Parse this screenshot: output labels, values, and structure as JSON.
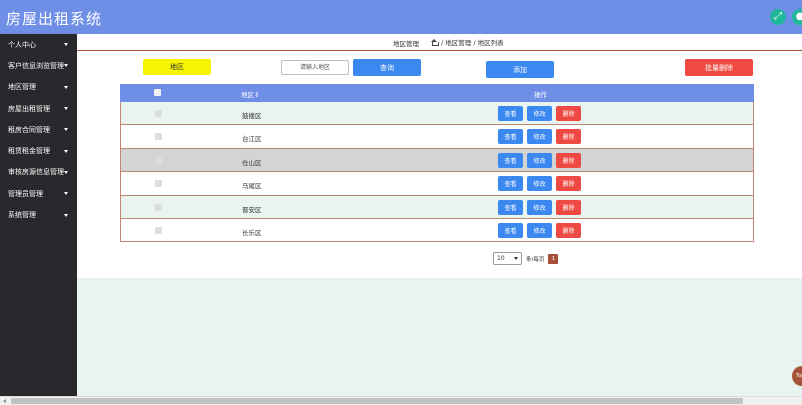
{
  "app": {
    "title": "房屋出租系统"
  },
  "header": {
    "icons": [
      "expand-icon",
      "user-icon"
    ]
  },
  "sidebar": {
    "items": [
      {
        "label": "个人中心"
      },
      {
        "label": "客户信息浏览管理"
      },
      {
        "label": "地区管理"
      },
      {
        "label": "房屋出租管理"
      },
      {
        "label": "租房合同管理"
      },
      {
        "label": "租赁租金管理"
      },
      {
        "label": "审核房源信息管理"
      },
      {
        "label": "管理员管理"
      },
      {
        "label": "系统管理"
      }
    ]
  },
  "breadcrumb": {
    "title": "地区管理",
    "path": "/ 地区管理 / 地区列表"
  },
  "toolbar": {
    "region_label": "地区",
    "search_placeholder": "请输入地区",
    "query_label": "查询",
    "add_label": "添加",
    "batch_delete_label": "批量删除"
  },
  "table": {
    "columns": {
      "name": "地区",
      "sort_indicator": "⇕",
      "actions": "操作"
    },
    "rows": [
      {
        "name": "鼓楼区"
      },
      {
        "name": "台江区"
      },
      {
        "name": "仓山区"
      },
      {
        "name": "马尾区"
      },
      {
        "name": "晋安区"
      },
      {
        "name": "长乐区"
      }
    ],
    "actions": {
      "view": "查看",
      "edit": "修改",
      "delete": "删除"
    }
  },
  "pagination": {
    "page_size": "10",
    "per_page_label": "条/每页",
    "current_page": "1"
  },
  "float_button": {
    "label": "Top"
  },
  "colors": {
    "header": "#6f8ee6",
    "sidebar": "#27292c",
    "primary": "#3b88f0",
    "danger": "#ee4a43",
    "region": "#f6f400",
    "accent": "#a84f3a"
  }
}
